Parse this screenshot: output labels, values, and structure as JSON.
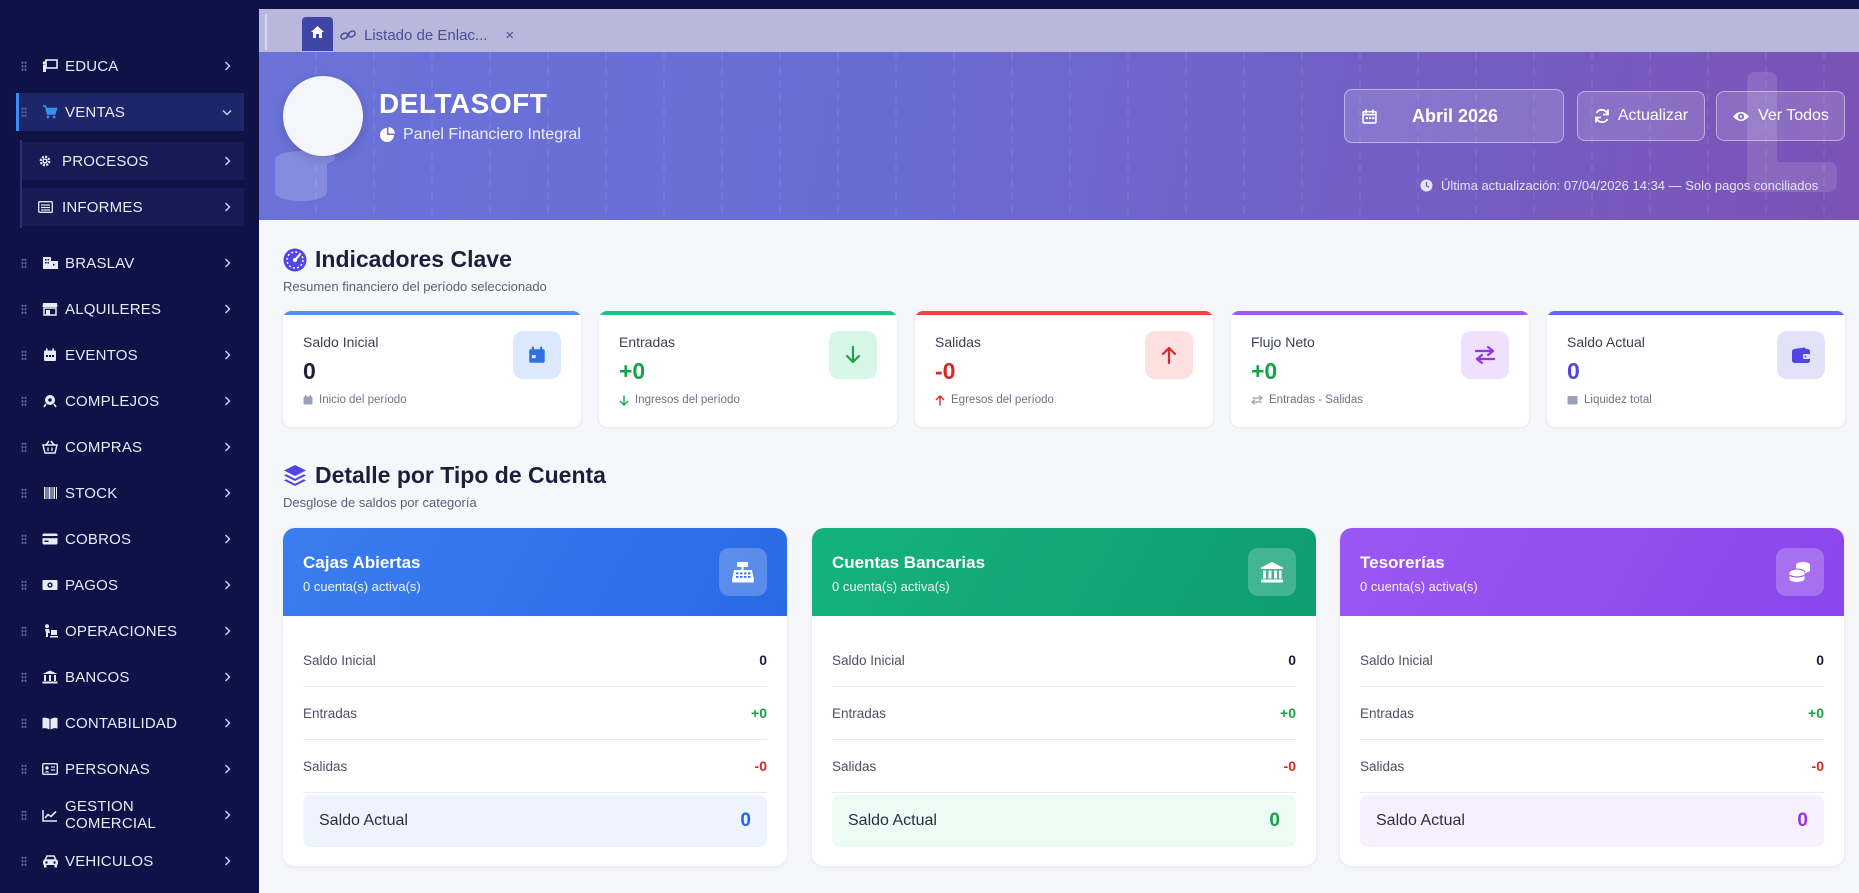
{
  "colors": {
    "sidebar_bg": "#0e1247",
    "accent_blue": "#3b82f6",
    "accent_green": "#10b981",
    "accent_red": "#ef4444",
    "accent_purple": "#8b5cf6",
    "accent_indigo": "#6366f1"
  },
  "sidebar": {
    "items": [
      {
        "label": "EDUCA",
        "icon": "chalkboard-icon"
      },
      {
        "label": "VENTAS",
        "icon": "cart-icon",
        "active": true,
        "expanded": true
      },
      {
        "label": "PROCESOS",
        "icon": "gear-icon",
        "sub": true
      },
      {
        "label": "INFORMES",
        "icon": "list-icon",
        "sub": true
      },
      {
        "label": "BRASLAV",
        "icon": "building-icon"
      },
      {
        "label": "ALQUILERES",
        "icon": "store-icon"
      },
      {
        "label": "EVENTOS",
        "icon": "calendar-icon"
      },
      {
        "label": "COMPLEJOS",
        "icon": "sparkle-icon"
      },
      {
        "label": "COMPRAS",
        "icon": "basket-icon"
      },
      {
        "label": "STOCK",
        "icon": "barcode-icon"
      },
      {
        "label": "COBROS",
        "icon": "credit-card-icon"
      },
      {
        "label": "PAGOS",
        "icon": "money-icon"
      },
      {
        "label": "OPERACIONES",
        "icon": "person-carry-icon"
      },
      {
        "label": "BANCOS",
        "icon": "bank-icon"
      },
      {
        "label": "CONTABILIDAD",
        "icon": "book-icon"
      },
      {
        "label": "PERSONAS",
        "icon": "id-card-icon"
      },
      {
        "label": "GESTION COMERCIAL",
        "icon": "chart-line-icon"
      },
      {
        "label": "VEHICULOS",
        "icon": "car-icon"
      }
    ]
  },
  "tabs": {
    "home_icon": "home-icon",
    "active_tab": {
      "label": "Listado de Enlac...",
      "icon": "link-icon"
    },
    "close_glyph": "×"
  },
  "hero": {
    "brand": "DELTASOFT",
    "tagline": "Panel Financiero Integral",
    "month": "Abril 2026",
    "refresh_label": "Actualizar",
    "view_all_label": "Ver Todos",
    "last_update": "Última actualización: 07/04/2026 14:34 — Solo pagos conciliados"
  },
  "kpis": {
    "title": "Indicadores Clave",
    "subtitle": "Resumen financiero del período seleccionado",
    "cards": [
      {
        "label": "Saldo Inicial",
        "value": "0",
        "foot": "Inicio del período",
        "icon": "calendar-icon",
        "color": "#3b82f6"
      },
      {
        "label": "Entradas",
        "value": "+0",
        "foot": "Ingresos del período",
        "icon": "arrow-down-icon",
        "color": "#10b981"
      },
      {
        "label": "Salidas",
        "value": "-0",
        "foot": "Egresos del período",
        "icon": "arrow-up-icon",
        "color": "#ef4444"
      },
      {
        "label": "Flujo Neto",
        "value": "+0",
        "foot": "Entradas - Salidas",
        "icon": "exchange-icon",
        "color": "#8b5cf6"
      },
      {
        "label": "Saldo Actual",
        "value": "0",
        "foot": "Liquidez total",
        "icon": "wallet-icon",
        "color": "#6366f1"
      }
    ]
  },
  "accounts": {
    "title": "Detalle por Tipo de Cuenta",
    "subtitle": "Desglose de saldos por categoría",
    "cards": [
      {
        "title": "Cajas Abiertas",
        "subtitle": "0 cuenta(s) activa(s)",
        "icon": "cash-register-icon",
        "rows": [
          {
            "label": "Saldo Inicial",
            "value": "0"
          },
          {
            "label": "Entradas",
            "value": "+0"
          },
          {
            "label": "Salidas",
            "value": "-0"
          }
        ],
        "total_label": "Saldo Actual",
        "total_value": "0"
      },
      {
        "title": "Cuentas Bancarias",
        "subtitle": "0 cuenta(s) activa(s)",
        "icon": "bank-icon",
        "rows": [
          {
            "label": "Saldo Inicial",
            "value": "0"
          },
          {
            "label": "Entradas",
            "value": "+0"
          },
          {
            "label": "Salidas",
            "value": "-0"
          }
        ],
        "total_label": "Saldo Actual",
        "total_value": "0"
      },
      {
        "title": "Tesorerías",
        "subtitle": "0 cuenta(s) activa(s)",
        "icon": "coins-icon",
        "rows": [
          {
            "label": "Saldo Inicial",
            "value": "0"
          },
          {
            "label": "Entradas",
            "value": "+0"
          },
          {
            "label": "Salidas",
            "value": "-0"
          }
        ],
        "total_label": "Saldo Actual",
        "total_value": "0"
      }
    ]
  }
}
